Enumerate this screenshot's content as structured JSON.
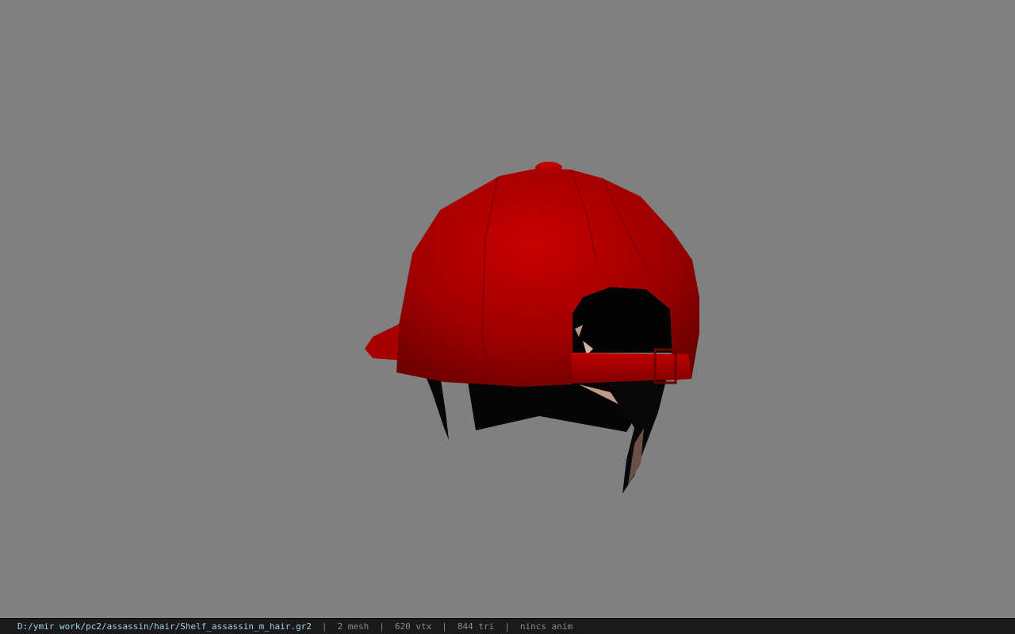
{
  "viewport": {
    "background": "#808080",
    "model": "baseball-cap-with-hair"
  },
  "status_bar": {
    "file_path": "D:/ymir work/pc2/assassin/hair/Shelf_assassin_m_hair.gr2",
    "separator": "|",
    "mesh": "2 mesh",
    "vertices": "620 vtx",
    "triangles": "844 tri",
    "animation": "nincs anim"
  },
  "colors": {
    "cap_red": "#b00000",
    "cap_dark": "#6e0000",
    "hair": "#050505",
    "status_bg": "#1a1a1a",
    "path_text": "#9fd0e8"
  }
}
